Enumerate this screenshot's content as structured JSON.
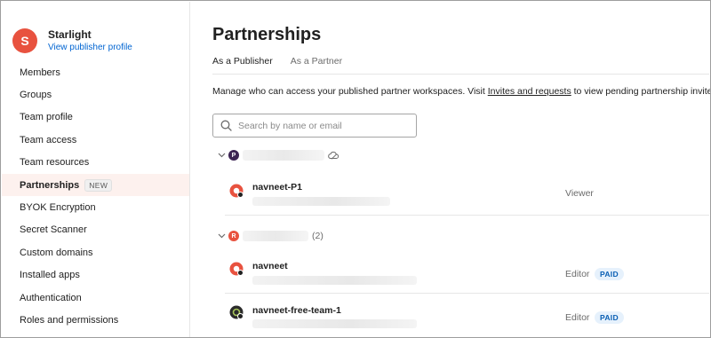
{
  "sidebar": {
    "org": {
      "initial": "S",
      "name": "Starlight",
      "profile_link": "View publisher profile"
    },
    "items": [
      {
        "label": "Members"
      },
      {
        "label": "Groups"
      },
      {
        "label": "Team profile"
      },
      {
        "label": "Team access"
      },
      {
        "label": "Team resources"
      },
      {
        "label": "Partnerships",
        "badge": "NEW",
        "active": true
      },
      {
        "label": "BYOK Encryption"
      },
      {
        "label": "Secret Scanner"
      },
      {
        "label": "Custom domains"
      },
      {
        "label": "Installed apps"
      },
      {
        "label": "Authentication"
      },
      {
        "label": "Roles and permissions"
      }
    ]
  },
  "main": {
    "title": "Partnerships",
    "tabs": [
      {
        "label": "As a Publisher",
        "active": true
      },
      {
        "label": "As a Partner"
      }
    ],
    "description": {
      "before": "Manage who can access your published partner workspaces. Visit ",
      "link": "Invites and requests",
      "after": " to view pending partnership invites."
    },
    "search": {
      "placeholder": "Search by name or email",
      "value": ""
    },
    "groups": [
      {
        "initial": "P",
        "color": "#3b2352",
        "icon": "cloud-icon",
        "rows": [
          {
            "name": "navneet-P1",
            "role": "Viewer",
            "icon_color": "#e8523f"
          }
        ]
      },
      {
        "initial": "R",
        "color": "#e8523f",
        "count": "(2)",
        "rows": [
          {
            "name": "navneet",
            "role": "Editor",
            "badge": "PAID",
            "icon_color": "#e8523f"
          },
          {
            "name": "navneet-free-team-1",
            "role": "Editor",
            "badge": "PAID",
            "icon_color": "#2b2b2b"
          }
        ]
      }
    ]
  },
  "colors": {
    "accent": "#e8523f",
    "link": "#0265d2",
    "paid_text": "#0a5fb4",
    "paid_bg": "#e6f1fc"
  }
}
